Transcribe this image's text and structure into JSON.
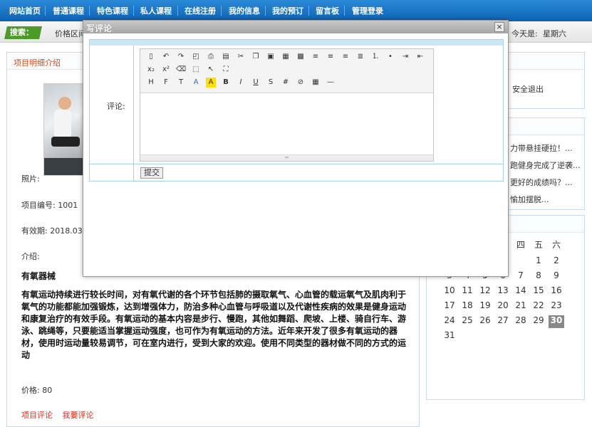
{
  "nav": {
    "items": [
      "网站首页",
      "普通课程",
      "特色课程",
      "私人课程",
      "在线注册",
      "我的信息",
      "我的预订",
      "留言板",
      "管理登录"
    ]
  },
  "search": {
    "label": "搜索：",
    "price": "价格区间",
    "today_label": "今天是:",
    "weekday": "星期六"
  },
  "detail": {
    "section_title": "项目明细介绍",
    "photo_label": "照片:",
    "number": "项目编号: 1001",
    "valid": "有效期: 2018.03.",
    "intro_label": "介绍:",
    "intro_title": "有氧器械",
    "intro_text": "有氧运动持续进行较长时间，对有氧代谢的各个环节包括肺的摄取氧气、心血管的载运氧气及肌肉利于氧气的功能都能加强锻炼，达到增强体力，防治多种心血管与呼吸道以及代谢性疾病的效果是健身运动和康复治疗的有效手段。有氧运动的基本内容是步行、慢跑，其他如舞蹈、爬坡、上楼、骑自行车、游泳、跳绳等，只要能适当掌握运动强度，也可作为有氧运动的方法。近年来开发了很多有氧运动的器材，使用时运动量较易调节，可在室内进行，受到大家的欢迎。使用不同类型的器材做不同的方式的运动",
    "price": "价格: 80",
    "link_comments": "项目评论",
    "link_write": "我要评论"
  },
  "sidebar": {
    "logout": "安全退出",
    "news": [
      "力带悬挂硬拉！...",
      "跑健身完成了逆袭...",
      "更好的成绩吗？...",
      "愉加摆脱..."
    ],
    "calendar": {
      "headers": [
        "四",
        "五",
        "六"
      ],
      "rows": [
        [
          "",
          "",
          "",
          "",
          "",
          "1",
          "2"
        ],
        [
          "3",
          "4",
          "5",
          "6",
          "7",
          "8",
          "9"
        ],
        [
          "10",
          "11",
          "12",
          "13",
          "14",
          "15",
          "16"
        ],
        [
          "17",
          "18",
          "19",
          "20",
          "21",
          "22",
          "23"
        ],
        [
          "24",
          "25",
          "26",
          "27",
          "28",
          "29",
          "30"
        ],
        [
          "31",
          "",
          "",
          "",
          "",
          "",
          ""
        ]
      ],
      "today": "30"
    }
  },
  "modal": {
    "title": "写评论",
    "close": "×",
    "field_label": "评论:",
    "submit": "提交",
    "toolbar_icons": [
      "source-icon",
      "undo-icon",
      "redo-icon",
      "preview-icon",
      "print-icon",
      "template-icon",
      "cut-icon",
      "copy-icon",
      "paste-icon",
      "paste-text-icon",
      "paste-word-icon",
      "align-left-icon",
      "align-center-icon",
      "align-right-icon",
      "justify-icon",
      "ordered-list-icon",
      "unordered-list-icon",
      "indent-icon",
      "outdent-icon",
      "subscript-icon",
      "superscript-icon",
      "clear-format-icon",
      "select-all-icon",
      "link-icon",
      "fullscreen-icon",
      "heading-icon",
      "font-family-icon",
      "font-size-icon",
      "font-color-icon",
      "highlight-icon",
      "bold-icon",
      "italic-icon",
      "underline-icon",
      "strikethrough-icon",
      "line-height-icon",
      "remove-format-icon",
      "table-icon",
      "hr-icon"
    ]
  }
}
